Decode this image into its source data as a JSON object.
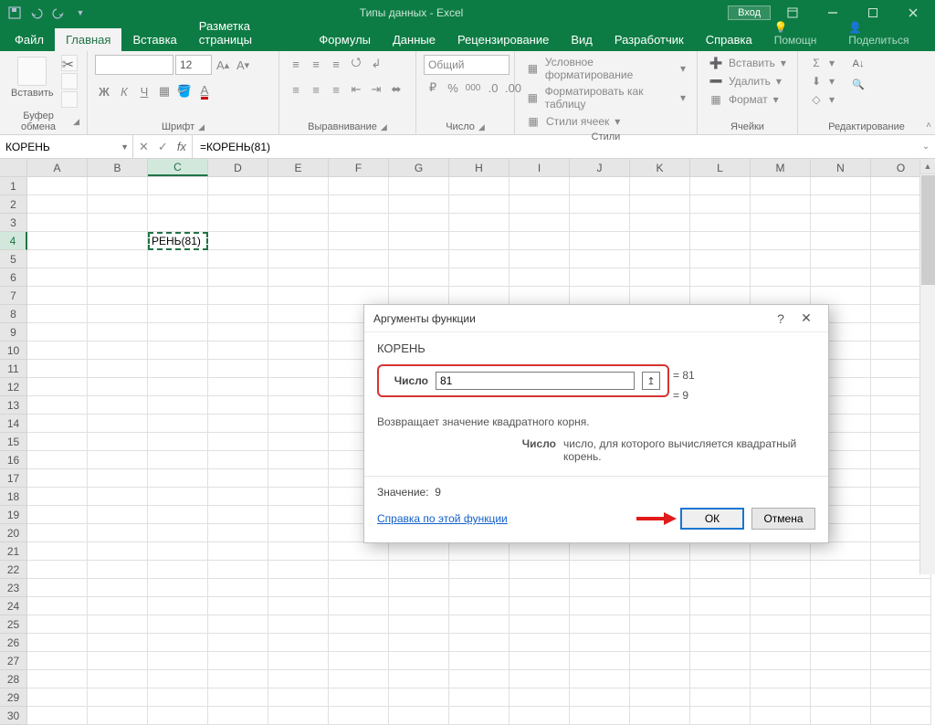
{
  "title_bar": {
    "app_title": "Типы данных - Excel",
    "login": "Вход"
  },
  "tabs": {
    "file": "Файл",
    "items": [
      "Главная",
      "Вставка",
      "Разметка страницы",
      "Формулы",
      "Данные",
      "Рецензирование",
      "Вид",
      "Разработчик",
      "Справка"
    ],
    "active_index": 0,
    "help": "Помощн",
    "share": "Поделиться"
  },
  "ribbon": {
    "clipboard": {
      "paste": "Вставить",
      "label": "Буфер обмена"
    },
    "font": {
      "size": "12",
      "label": "Шрифт",
      "bold": "Ж",
      "italic": "К",
      "underline": "Ч"
    },
    "alignment": {
      "label": "Выравнивание"
    },
    "number": {
      "format": "Общий",
      "label": "Число",
      "percent": "%",
      "thousands": "000",
      "currency": "₽"
    },
    "styles": {
      "cond": "Условное форматирование",
      "astable": "Форматировать как таблицу",
      "cellstyles": "Стили ячеек",
      "label": "Стили"
    },
    "cells": {
      "insert": "Вставить",
      "delete": "Удалить",
      "format": "Формат",
      "label": "Ячейки"
    },
    "editing": {
      "label": "Редактирование"
    }
  },
  "formula_bar": {
    "name_box": "КОРЕНЬ",
    "fx": "fx",
    "formula": "=КОРЕНЬ(81)"
  },
  "grid": {
    "columns": [
      "A",
      "B",
      "C",
      "D",
      "E",
      "F",
      "G",
      "H",
      "I",
      "J",
      "K",
      "L",
      "M",
      "N",
      "O"
    ],
    "active_col_index": 2,
    "rows": 30,
    "active_row": 4,
    "active_cell_text": "РЕНЬ(81)"
  },
  "dialog": {
    "title": "Аргументы функции",
    "func": "КОРЕНЬ",
    "arg_label": "Число",
    "arg_value": "81",
    "eq1": "= 81",
    "eq2": "= 9",
    "desc": "Возвращает значение квадратного корня.",
    "arg_name": "Число",
    "arg_desc": "число, для которого вычисляется квадратный корень.",
    "value_label": "Значение:",
    "value": "9",
    "help": "Справка по этой функции",
    "ok": "ОК",
    "cancel": "Отмена"
  }
}
